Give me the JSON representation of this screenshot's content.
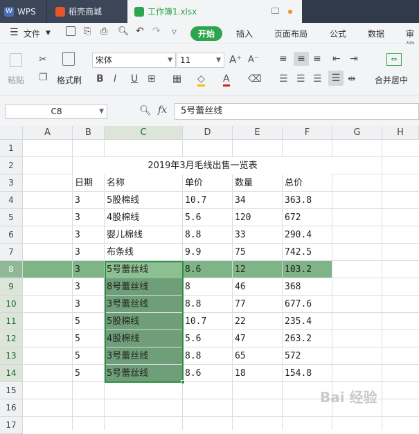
{
  "tabs": {
    "wps": "WPS",
    "shop": "稻壳商城",
    "book": "工作簿1.xlsx"
  },
  "menu": {
    "file": "文件",
    "start": "开始",
    "insert": "插入",
    "layout": "页面布局",
    "formula": "公式",
    "data": "数据",
    "review": "审阅"
  },
  "ribbon": {
    "paste": "粘贴",
    "format_painter": "格式刷",
    "font_name": "宋体",
    "font_size": "11",
    "merge_center": "合并居中"
  },
  "formula_bar": {
    "name_box": "C8",
    "fx": "fx",
    "value": "5号蕾丝线"
  },
  "columns": [
    "A",
    "B",
    "C",
    "D",
    "E",
    "F",
    "G",
    "H"
  ],
  "rows": [
    "1",
    "2",
    "3",
    "4",
    "5",
    "6",
    "7",
    "8",
    "9",
    "10",
    "11",
    "12",
    "13",
    "14",
    "15",
    "16",
    "17"
  ],
  "sheet": {
    "title": "2019年3月毛线出售一览表",
    "headers": [
      "日期",
      "名称",
      "单价",
      "数量",
      "总价"
    ],
    "records": [
      [
        "3",
        "5股棉线",
        "10.7",
        "34",
        "363.8"
      ],
      [
        "3",
        "4股棉线",
        "5.6",
        "120",
        "672"
      ],
      [
        "3",
        "婴儿棉线",
        "8.8",
        "33",
        "290.4"
      ],
      [
        "3",
        "布条线",
        "9.9",
        "75",
        "742.5"
      ],
      [
        "3",
        "5号蕾丝线",
        "8.6",
        "12",
        "103.2"
      ],
      [
        "3",
        "8号蕾丝线",
        "8",
        "46",
        "368"
      ],
      [
        "3",
        "3号蕾丝线",
        "8.8",
        "77",
        "677.6"
      ],
      [
        "5",
        "5股棉线",
        "10.7",
        "22",
        "235.4"
      ],
      [
        "5",
        "4股棉线",
        "5.6",
        "47",
        "263.2"
      ],
      [
        "5",
        "3号蕾丝线",
        "8.8",
        "65",
        "572"
      ],
      [
        "5",
        "5号蕾丝线",
        "8.6",
        "18",
        "154.8"
      ]
    ]
  },
  "watermark": "Bai 经验",
  "colors": {
    "accent": "#2ea44f",
    "selection": "#6f9f78",
    "titlebar": "#2f3a4a"
  }
}
